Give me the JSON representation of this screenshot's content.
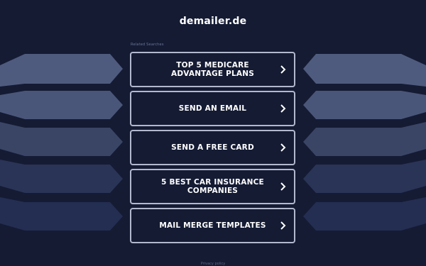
{
  "site": {
    "title": "demailer.de"
  },
  "related": {
    "label": "Related Searches",
    "links": [
      {
        "label": "TOP 5 MEDICARE ADVANTAGE PLANS",
        "icon": "chevron-right-icon"
      },
      {
        "label": "SEND AN EMAIL",
        "icon": "chevron-right-icon"
      },
      {
        "label": "SEND A FREE CARD",
        "icon": "chevron-right-icon"
      },
      {
        "label": "5 BEST CAR INSURANCE COMPANIES",
        "icon": "chevron-right-icon"
      },
      {
        "label": "MAIL MERGE TEMPLATES",
        "icon": "chevron-right-icon"
      }
    ]
  },
  "footer": {
    "privacy_label": "Privacy policy"
  },
  "colors": {
    "background": "#141b33",
    "button_border": "#b2b9cf",
    "decor_light": "#4f5b7e",
    "decor_mid": "#3a4566",
    "decor_dark": "#242e52"
  }
}
